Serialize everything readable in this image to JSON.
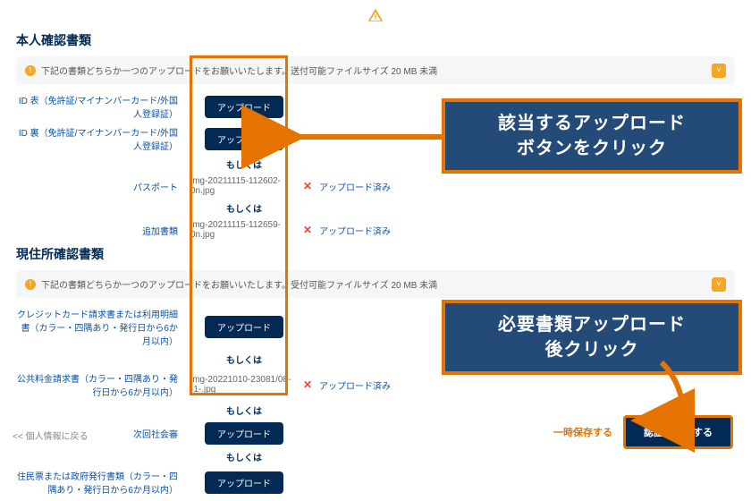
{
  "warn_icon": "warning-icon",
  "identity": {
    "title": "本人確認書類",
    "note": "下記の書類どちらか一つのアップロードをお願いいたします。送付可能ファイルサイズ 20 MB 未満",
    "rows": [
      {
        "label": "ID 表（免許証/マイナンバーカード/外国人登録証）",
        "btn": "アップロード"
      },
      {
        "label": "ID 裏（免許証/マイナンバーカード/外国人登録証）",
        "btn": "アップロード"
      }
    ],
    "or": "もしくは",
    "passport": {
      "label": "パスポート",
      "file": "img-20211115-112602-0n.jpg",
      "done": "アップロード済み"
    },
    "extra": {
      "label": "追加書類",
      "file": "img-20211115-112659-0n.jpg",
      "done": "アップロード済み"
    }
  },
  "address": {
    "title": "現住所確認書類",
    "note": "下記の書類どちらか一つのアップロードをお願いいたします。受付可能ファイルサイズ 20 MB 未満",
    "rows": [
      {
        "label": "クレジットカード請求書または利用明細書（カラー・四隅あり・発行日から6か月以内）",
        "btn": "アップロード"
      }
    ],
    "util": {
      "label": "公共料金請求書（カラー・四隅あり・発行日から6か月以内）",
      "file": "img-20221010-23081/08--1-.jpg",
      "done": "アップロード済み"
    },
    "extra2": {
      "label": "次回社会審",
      "btn": "アップロード"
    },
    "resident": {
      "label": "住民票または政府発行書類（カラー・四隅あり・発行日から6か月以内）",
      "btn": "アップロード"
    }
  },
  "or": "もしくは",
  "back": "<< 個人情報に戻る",
  "save_btn": "一時保存する",
  "submit_btn": "認証を送信する",
  "callout1_l1": "該当するアップロード",
  "callout1_l2": "ボタンをクリック",
  "callout2_l1": "必要書類アップロード",
  "callout2_l2": "後クリック"
}
